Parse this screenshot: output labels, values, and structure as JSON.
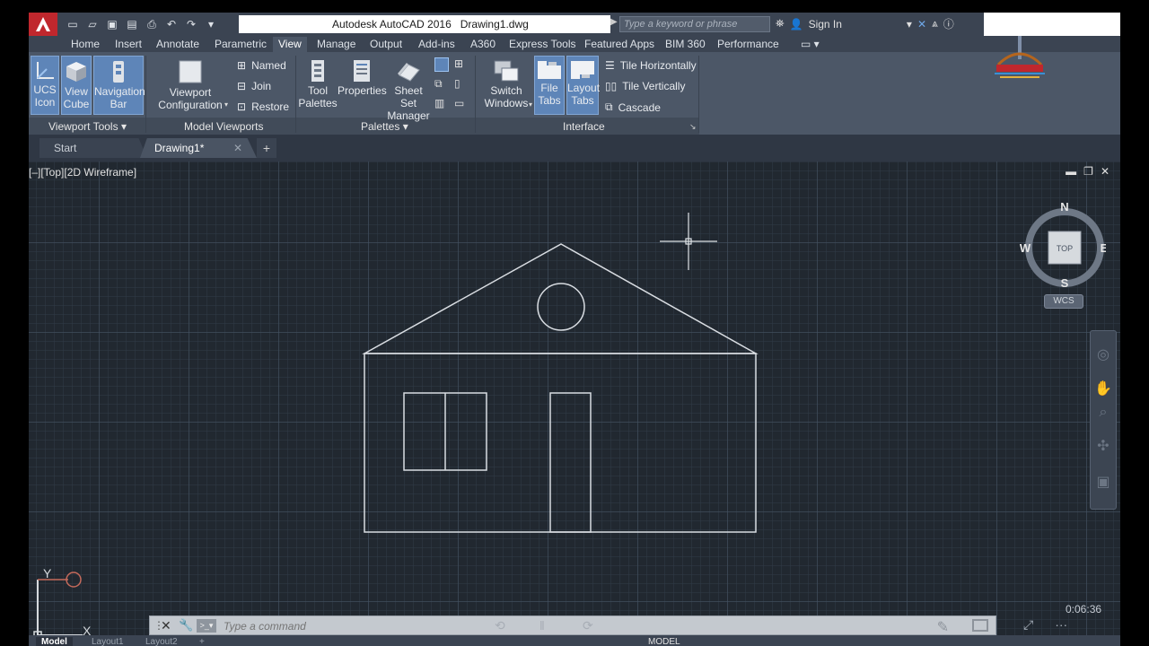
{
  "window": {
    "app_title": "Autodesk AutoCAD 2016",
    "doc_title": "Drawing1.dwg",
    "search_placeholder": "Type a keyword or phrase",
    "sign_in": "Sign In",
    "controls": {
      "minimize": "—",
      "restore": "❐",
      "close": "✕"
    }
  },
  "ribbon_tabs": [
    "Home",
    "Insert",
    "Annotate",
    "Parametric",
    "View",
    "Manage",
    "Output",
    "Add-ins",
    "A360",
    "Express Tools",
    "Featured Apps",
    "BIM 360",
    "Performance"
  ],
  "active_ribbon_tab": "View",
  "panels": {
    "viewport_tools": {
      "title": "Viewport Tools",
      "buttons": [
        "UCS\nIcon",
        "View\nCube",
        "Navigation\nBar"
      ]
    },
    "model_viewports": {
      "title": "Model Viewports",
      "big": "Viewport\nConfiguration",
      "small": [
        "Named",
        "Join",
        "Restore"
      ]
    },
    "palettes": {
      "title": "Palettes",
      "buttons": [
        "Tool\nPalettes",
        "Properties",
        "Sheet Set\nManager"
      ]
    },
    "interface": {
      "title": "Interface",
      "buttons": [
        "Switch\nWindows",
        "File\nTabs",
        "Layout\nTabs"
      ],
      "small": [
        "Tile Horizontally",
        "Tile Vertically",
        "Cascade"
      ]
    }
  },
  "file_tabs": {
    "start": "Start",
    "drawing": "Drawing1*",
    "add": "+"
  },
  "viewport": {
    "label": "[–][Top][2D Wireframe]",
    "viewcube": {
      "n": "N",
      "s": "S",
      "e": "E",
      "w": "W",
      "face": "TOP"
    },
    "wcs": "WCS",
    "ucs_y": "Y",
    "ucs_x": "X",
    "timer": "0:06:36"
  },
  "command_line": {
    "placeholder": "Type a command"
  },
  "layout_tabs": [
    "Model",
    "Layout1",
    "Layout2",
    "+"
  ],
  "status": {
    "model": "MODEL"
  },
  "colors": {
    "drawing_lines": "#d9dde2",
    "active_tab_bg": "#5e85b8",
    "logo_red": "#c0272d"
  }
}
